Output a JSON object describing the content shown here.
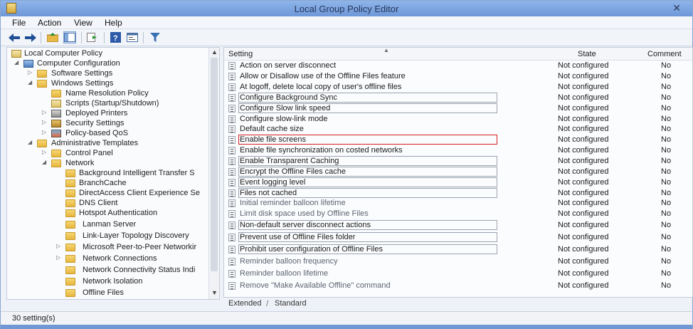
{
  "window": {
    "title": "Local Group Policy Editor",
    "close_glyph": "✕"
  },
  "menu": [
    "File",
    "Action",
    "View",
    "Help"
  ],
  "toolbar": {
    "buttons": [
      "back-icon",
      "forward-icon",
      "up-folder-icon",
      "show-hide-tree-icon",
      "export-list-icon",
      "help-icon",
      "properties-icon",
      "filter-icon"
    ]
  },
  "tree": [
    {
      "label": "Local Computer Policy",
      "icon": "policy",
      "expander": ""
    },
    {
      "label": "Computer Configuration",
      "icon": "computer",
      "expander": "◢"
    },
    {
      "label": "Software Settings",
      "icon": "folder",
      "expander": "▷"
    },
    {
      "label": "Windows Settings",
      "icon": "folder",
      "expander": "◢"
    },
    {
      "label": "Name Resolution Policy",
      "icon": "folder",
      "expander": ""
    },
    {
      "label": "Scripts (Startup/Shutdown)",
      "icon": "policy",
      "expander": ""
    },
    {
      "label": "Deployed Printers",
      "icon": "printer",
      "expander": "▷"
    },
    {
      "label": "Security Settings",
      "icon": "shield",
      "expander": "▷"
    },
    {
      "label": "Policy-based QoS",
      "icon": "chart",
      "expander": "▷"
    },
    {
      "label": "Administrative Templates",
      "icon": "folder",
      "expander": "◢"
    },
    {
      "label": "Control Panel",
      "icon": "folder",
      "expander": "▷"
    },
    {
      "label": "Network",
      "icon": "folder",
      "expander": "◢"
    },
    {
      "label": "Background Intelligent Transfer S",
      "icon": "folder",
      "expander": ""
    },
    {
      "label": "BranchCache",
      "icon": "folder",
      "expander": ""
    },
    {
      "label": "DirectAccess Client Experience Se",
      "icon": "folder",
      "expander": ""
    },
    {
      "label": "DNS Client",
      "icon": "folder",
      "expander": ""
    },
    {
      "label": "Hotspot Authentication",
      "icon": "folder",
      "expander": ""
    },
    {
      "label": "Lanman Server",
      "icon": "folder",
      "expander": ""
    },
    {
      "label": "Link-Layer Topology Discovery",
      "icon": "folder",
      "expander": ""
    },
    {
      "label": "Microsoft Peer-to-Peer Networkir",
      "icon": "folder",
      "expander": "▷"
    },
    {
      "label": "Network Connections",
      "icon": "folder",
      "expander": "▷"
    },
    {
      "label": "Network Connectivity Status Indi",
      "icon": "folder",
      "expander": ""
    },
    {
      "label": "Network Isolation",
      "icon": "folder",
      "expander": ""
    },
    {
      "label": "Offline Files",
      "icon": "folder",
      "expander": ""
    }
  ],
  "details": {
    "columns": {
      "setting": "Setting",
      "state": "State",
      "comment": "Comment"
    },
    "rows": [
      {
        "name": "Action on server disconnect",
        "state": "Not configured",
        "comment": "No"
      },
      {
        "name": "Allow or Disallow use of the Offline Files feature",
        "state": "Not configured",
        "comment": "No"
      },
      {
        "name": "At logoff, delete local copy of user's offline files",
        "state": "Not configured",
        "comment": "No"
      },
      {
        "name": "Configure Background Sync",
        "state": "Not configured",
        "comment": "No"
      },
      {
        "name": "Configure Slow link speed",
        "state": "Not configured",
        "comment": "No"
      },
      {
        "name": "Configure slow-link mode",
        "state": "Not configured",
        "comment": "No"
      },
      {
        "name": "Default cache size",
        "state": "Not configured",
        "comment": "No"
      },
      {
        "name": "Enable file screens",
        "state": "Not configured",
        "comment": "No"
      },
      {
        "name": "Enable file synchronization on costed networks",
        "state": "Not configured",
        "comment": "No"
      },
      {
        "name": "Enable Transparent Caching",
        "state": "Not configured",
        "comment": "No"
      },
      {
        "name": "Encrypt the Offline Files cache",
        "state": "Not configured",
        "comment": "No"
      },
      {
        "name": "Event logging level",
        "state": "Not configured",
        "comment": "No"
      },
      {
        "name": "Files not cached",
        "state": "Not configured",
        "comment": "No"
      },
      {
        "name": "Initial reminder balloon lifetime",
        "state": "Not configured",
        "comment": "No"
      },
      {
        "name": "Limit disk space used by Offline Files",
        "state": "Not configured",
        "comment": "No"
      },
      {
        "name": "Non-default server disconnect actions",
        "state": "Not configured",
        "comment": "No"
      },
      {
        "name": "Prevent use of Offline Files folder",
        "state": "Not configured",
        "comment": "No"
      },
      {
        "name": "Prohibit user configuration of Offline Files",
        "state": "Not configured",
        "comment": "No"
      },
      {
        "name": "Reminder balloon frequency",
        "state": "Not configured",
        "comment": "No"
      },
      {
        "name": "Reminder balloon lifetime",
        "state": "Not configured",
        "comment": "No"
      },
      {
        "name": "Remove \"Make Available Offline\" command",
        "state": "Not configured",
        "comment": "No"
      }
    ]
  },
  "tabs": {
    "extended": "Extended",
    "standard": "Standard"
  },
  "status": {
    "text": "30 setting(s)"
  }
}
